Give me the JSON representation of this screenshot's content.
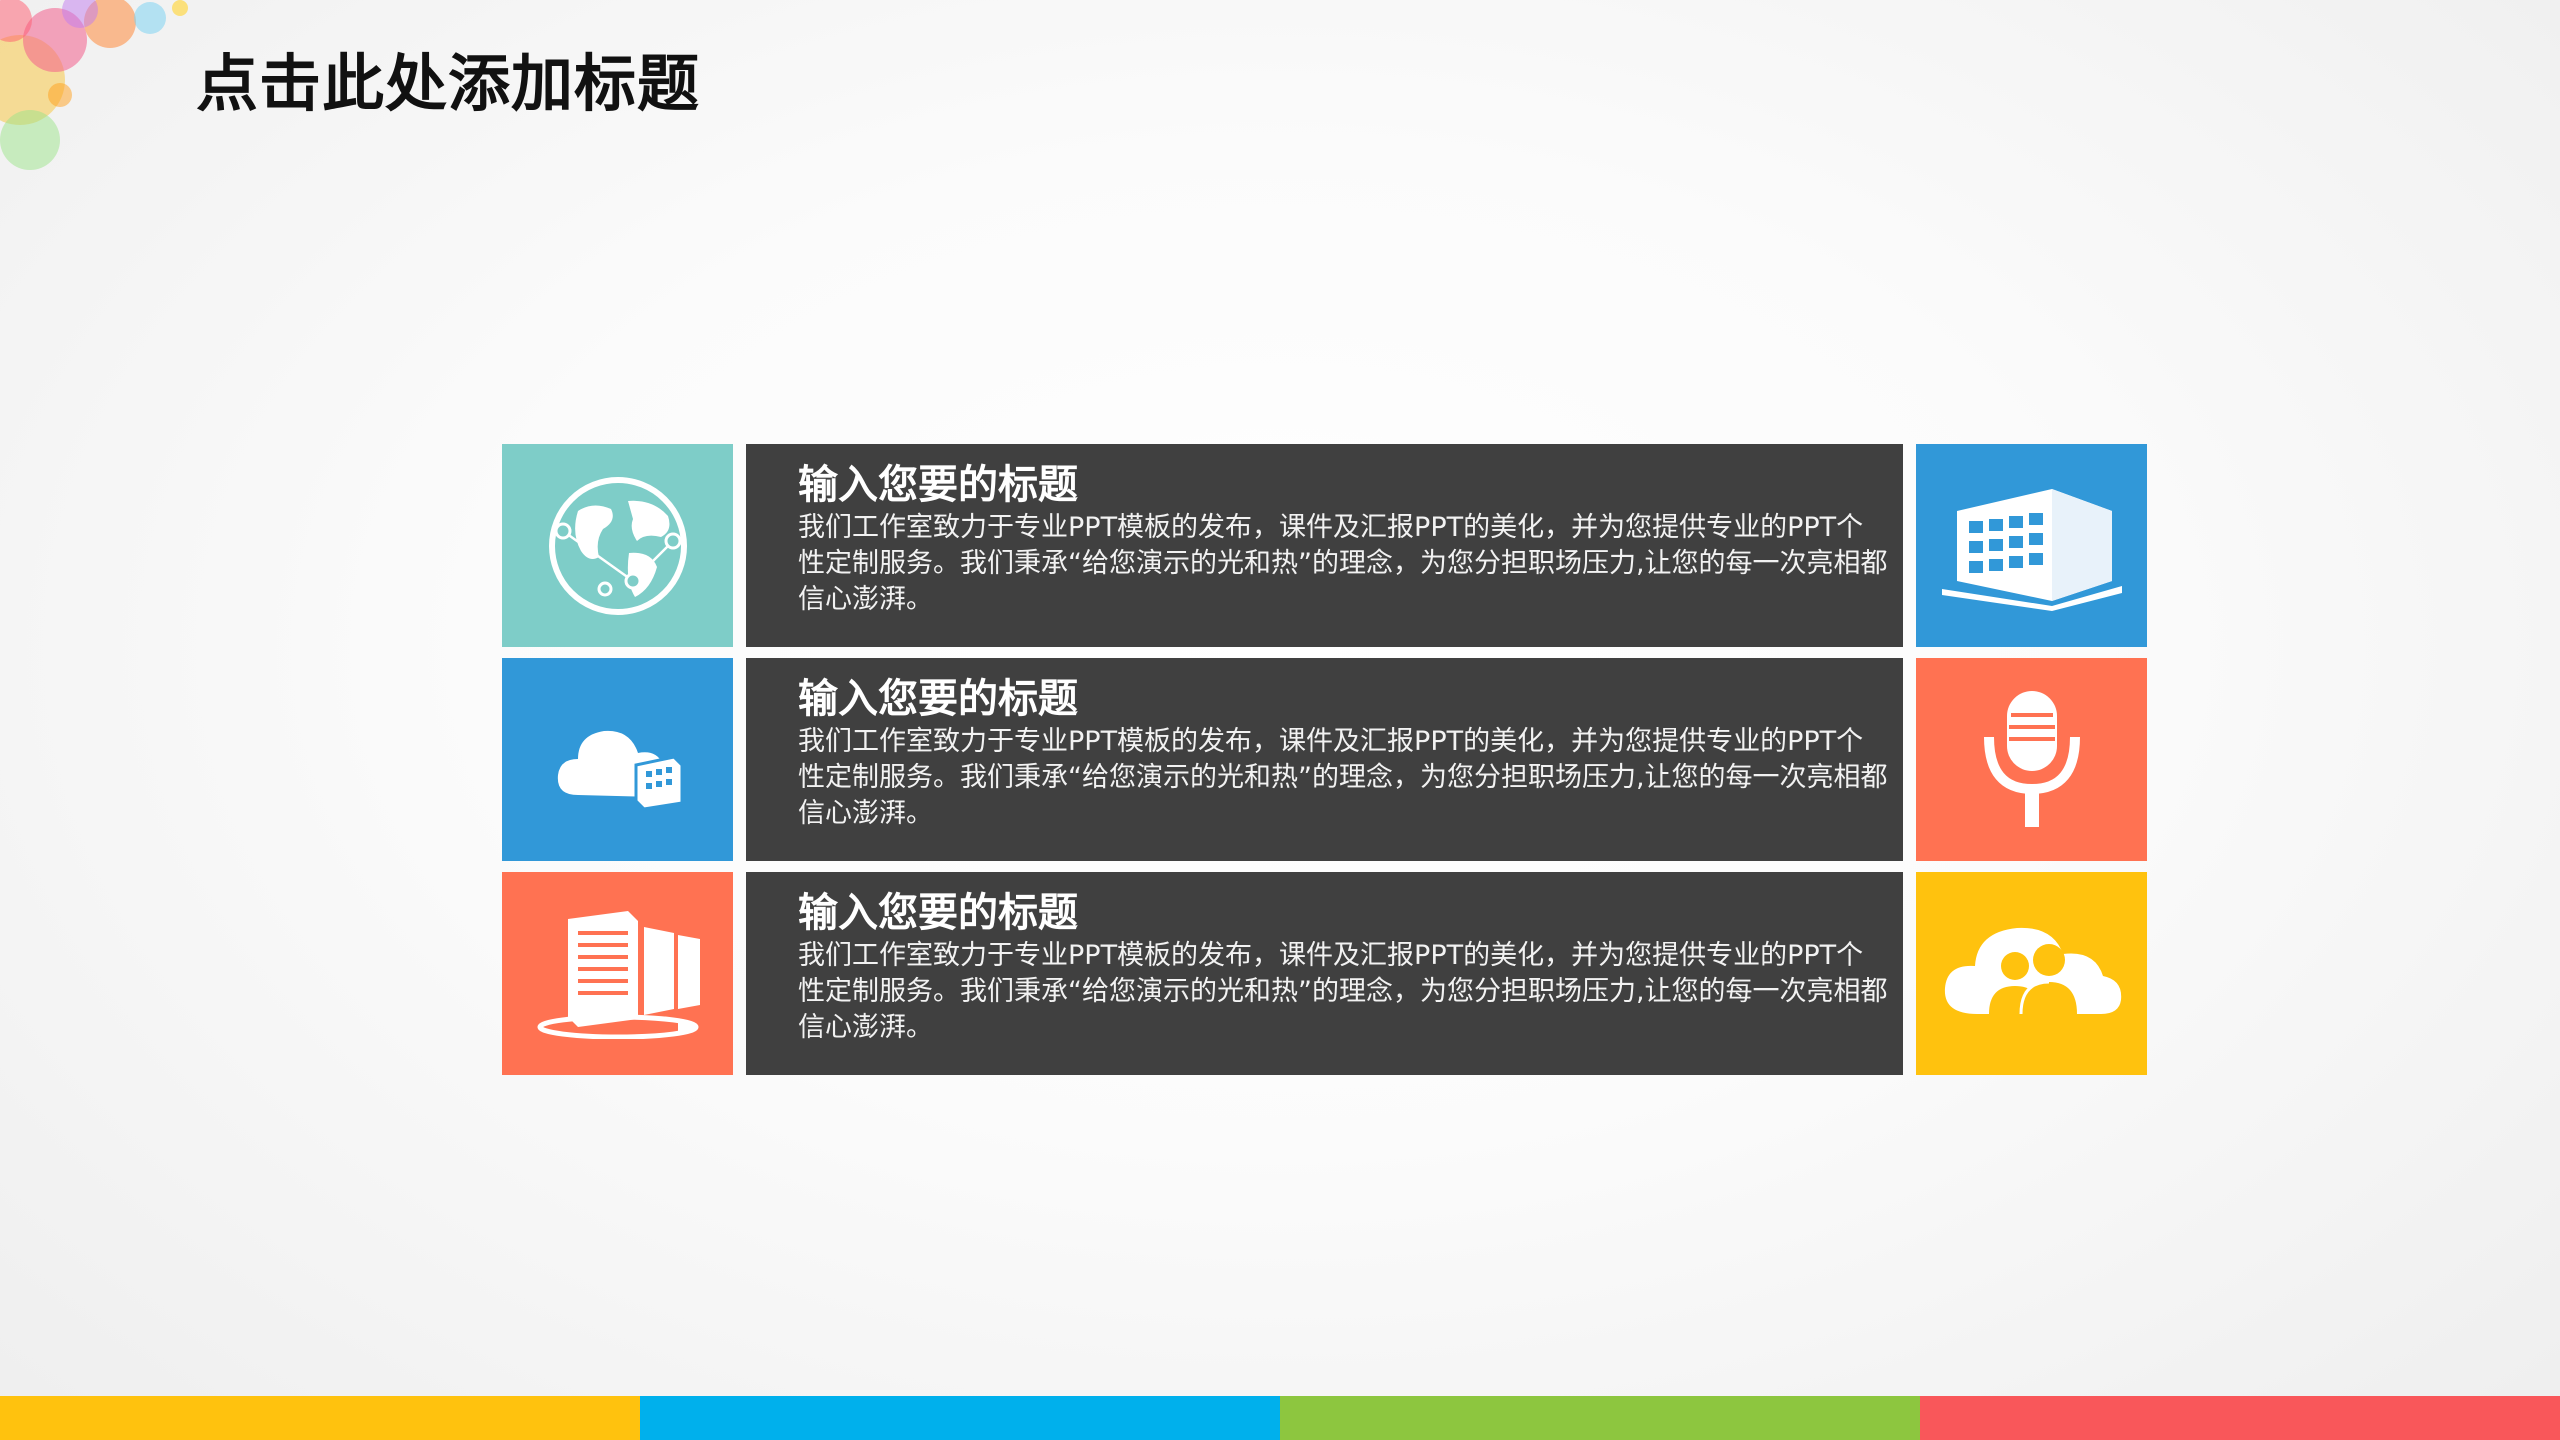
{
  "slide": {
    "title": "点击此处添加标题"
  },
  "rows": [
    {
      "title": "输入您要的标题",
      "body": "我们工作室致力于专业PPT模板的发布，课件及汇报PPT的美化，并为您提供专业的PPT个性定制服务。我们秉承“给您演示的光和热”的理念，为您分担职场压力,让您的每一次亮相都信心澎湃。",
      "left_icon": "globe-network-icon",
      "left_color": "#7ecdc8",
      "right_icon": "building-icon",
      "right_color": "#3198d8"
    },
    {
      "title": "输入您要的标题",
      "body": "我们工作室致力于专业PPT模板的发布，课件及汇报PPT的美化，并为您提供专业的PPT个性定制服务。我们秉承“给您演示的光和热”的理念，为您分担职场压力,让您的每一次亮相都信心澎湃。",
      "left_icon": "cloud-building-icon",
      "left_color": "#3198d8",
      "right_icon": "microphone-icon",
      "right_color": "#ff7252"
    },
    {
      "title": "输入您要的标题",
      "body": "我们工作室致力于专业PPT模板的发布，课件及汇报PPT的美化，并为您提供专业的PPT个性定制服务。我们秉承“给您演示的光和热”的理念，为您分担职场压力,让您的每一次亮相都信心澎湃。",
      "left_icon": "server-rack-icon",
      "left_color": "#ff7252",
      "right_icon": "cloud-users-icon",
      "right_color": "#ffc20e"
    }
  ],
  "bottom_stripe_colors": [
    "#ffc20e",
    "#00b0ec",
    "#8dc63f",
    "#f9575a"
  ]
}
